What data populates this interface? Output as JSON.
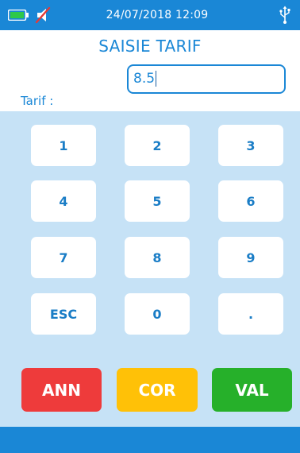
{
  "status_bar": {
    "datetime": "24/07/2018 12:09",
    "icons": [
      "battery-icon",
      "speaker-muted-icon",
      "usb-icon"
    ]
  },
  "screen": {
    "title": "SAISIE TARIF"
  },
  "tarif": {
    "label": "Tarif :",
    "value": "8.5"
  },
  "keypad": {
    "keys": [
      "1",
      "2",
      "3",
      "4",
      "5",
      "6",
      "7",
      "8",
      "9",
      "ESC",
      "0",
      "."
    ]
  },
  "actions": {
    "cancel_label": "ANN",
    "correct_label": "COR",
    "validate_label": "VAL"
  },
  "colors": {
    "primary_blue": "#1a87d6",
    "panel_light_blue": "#c6e2f6",
    "cancel_red": "#ee3b3b",
    "correct_yellow": "#ffc107",
    "validate_green": "#26b02a"
  }
}
